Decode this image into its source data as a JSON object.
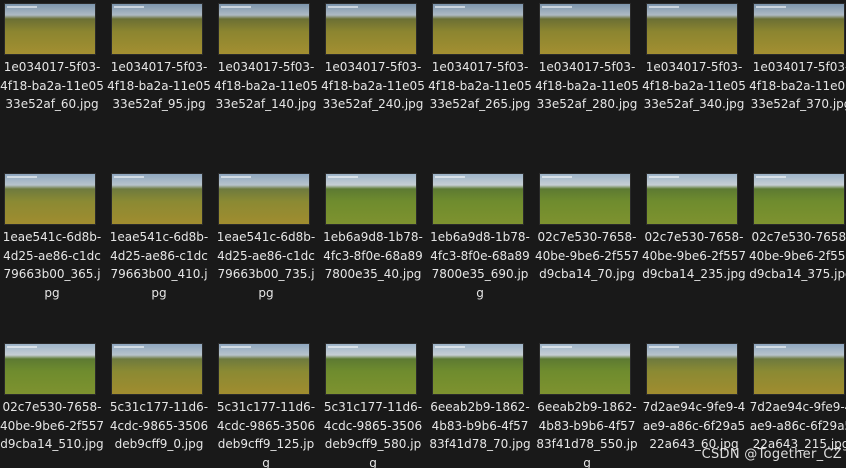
{
  "files": [
    {
      "name": "1e034017-5f03-4f18-ba2a-11e0533e52af_60.jpg",
      "tone": "dark"
    },
    {
      "name": "1e034017-5f03-4f18-ba2a-11e0533e52af_95.jpg",
      "tone": "dark"
    },
    {
      "name": "1e034017-5f03-4f18-ba2a-11e0533e52af_140.jpg",
      "tone": "dark"
    },
    {
      "name": "1e034017-5f03-4f18-ba2a-11e0533e52af_240.jpg",
      "tone": "dark"
    },
    {
      "name": "1e034017-5f03-4f18-ba2a-11e0533e52af_265.jpg",
      "tone": "dark"
    },
    {
      "name": "1e034017-5f03-4f18-ba2a-11e0533e52af_280.jpg",
      "tone": "dark"
    },
    {
      "name": "1e034017-5f03-4f18-ba2a-11e0533e52af_340.jpg",
      "tone": "dark"
    },
    {
      "name": "1e034017-5f03-4f18-ba2a-11e0533e52af_370.jpg",
      "tone": "dark"
    },
    {
      "name": "1eae541c-6d8b-4d25-ae86-c1dc79663b00_365.jpg",
      "tone": "normal"
    },
    {
      "name": "1eae541c-6d8b-4d25-ae86-c1dc79663b00_410.jpg",
      "tone": "normal"
    },
    {
      "name": "1eae541c-6d8b-4d25-ae86-c1dc79663b00_735.jpg",
      "tone": "normal"
    },
    {
      "name": "1eb6a9d8-1b78-4fc3-8f0e-68a897800e35_40.jpg",
      "tone": "green"
    },
    {
      "name": "1eb6a9d8-1b78-4fc3-8f0e-68a897800e35_690.jpg",
      "tone": "green"
    },
    {
      "name": "02c7e530-7658-40be-9be6-2f557d9cba14_70.jpg",
      "tone": "green"
    },
    {
      "name": "02c7e530-7658-40be-9be6-2f557d9cba14_235.jpg",
      "tone": "green"
    },
    {
      "name": "02c7e530-7658-40be-9be6-2f557d9cba14_375.jpg",
      "tone": "green"
    },
    {
      "name": "02c7e530-7658-40be-9be6-2f557d9cba14_510.jpg",
      "tone": "green"
    },
    {
      "name": "5c31c177-11d6-4cdc-9865-3506deb9cff9_0.jpg",
      "tone": "normal"
    },
    {
      "name": "5c31c177-11d6-4cdc-9865-3506deb9cff9_125.jpg",
      "tone": "normal"
    },
    {
      "name": "5c31c177-11d6-4cdc-9865-3506deb9cff9_580.jpg",
      "tone": "green"
    },
    {
      "name": "6eeab2b9-1862-4b83-b9b6-4f5783f41d78_70.jpg",
      "tone": "green"
    },
    {
      "name": "6eeab2b9-1862-4b83-b9b6-4f5783f41d78_550.jpg",
      "tone": "green"
    },
    {
      "name": "7d2ae94c-9fe9-4ae9-a86c-6f29a522a643_60.jpg",
      "tone": "normal"
    },
    {
      "name": "7d2ae94c-9fe9-4ae9-a86c-6f29a522a643_215.jpg",
      "tone": "normal"
    }
  ],
  "watermark": "CSDN @Together_CZ"
}
